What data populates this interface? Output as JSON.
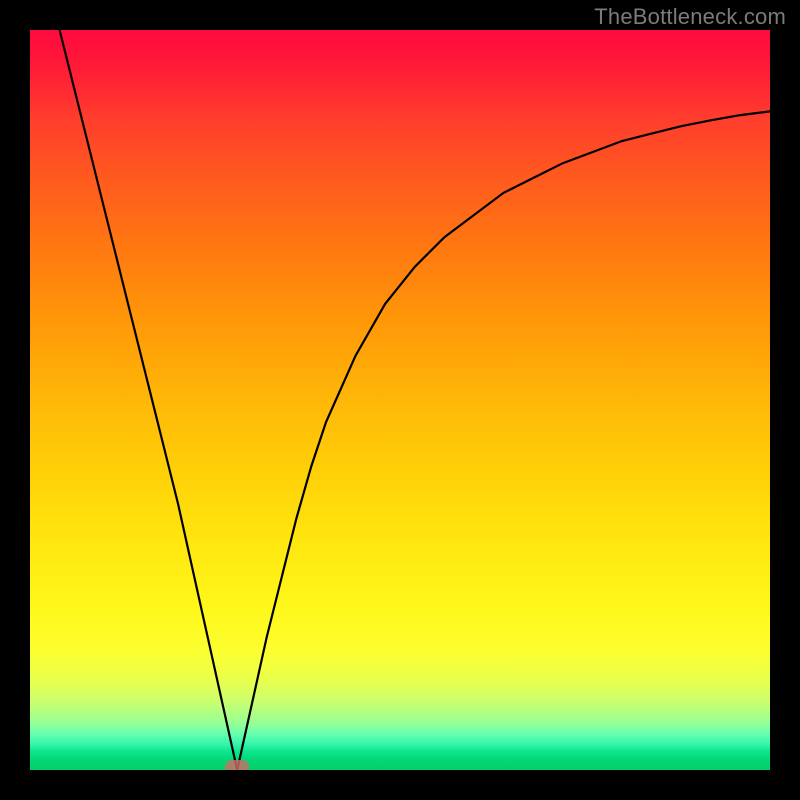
{
  "watermark": "TheBottleneck.com",
  "chart_data": {
    "type": "line",
    "title": "",
    "xlabel": "",
    "ylabel": "",
    "xlim": [
      0,
      100
    ],
    "ylim": [
      0,
      100
    ],
    "grid": false,
    "legend": false,
    "min_point": {
      "x": 28,
      "y": 0
    },
    "series": [
      {
        "name": "curve",
        "points": [
          {
            "x": 4,
            "y": 100
          },
          {
            "x": 6,
            "y": 92
          },
          {
            "x": 8,
            "y": 84
          },
          {
            "x": 10,
            "y": 76
          },
          {
            "x": 12,
            "y": 68
          },
          {
            "x": 14,
            "y": 60
          },
          {
            "x": 16,
            "y": 52
          },
          {
            "x": 18,
            "y": 44
          },
          {
            "x": 20,
            "y": 36
          },
          {
            "x": 22,
            "y": 27
          },
          {
            "x": 24,
            "y": 18
          },
          {
            "x": 26,
            "y": 9
          },
          {
            "x": 28,
            "y": 0
          },
          {
            "x": 30,
            "y": 9
          },
          {
            "x": 32,
            "y": 18
          },
          {
            "x": 34,
            "y": 26
          },
          {
            "x": 36,
            "y": 34
          },
          {
            "x": 38,
            "y": 41
          },
          {
            "x": 40,
            "y": 47
          },
          {
            "x": 44,
            "y": 56
          },
          {
            "x": 48,
            "y": 63
          },
          {
            "x": 52,
            "y": 68
          },
          {
            "x": 56,
            "y": 72
          },
          {
            "x": 60,
            "y": 75
          },
          {
            "x": 64,
            "y": 78
          },
          {
            "x": 68,
            "y": 80
          },
          {
            "x": 72,
            "y": 82
          },
          {
            "x": 76,
            "y": 83.5
          },
          {
            "x": 80,
            "y": 85
          },
          {
            "x": 84,
            "y": 86
          },
          {
            "x": 88,
            "y": 87
          },
          {
            "x": 92,
            "y": 87.8
          },
          {
            "x": 96,
            "y": 88.5
          },
          {
            "x": 100,
            "y": 89
          }
        ]
      }
    ],
    "gradient_stops": [
      {
        "pos": 0,
        "color": "#ff0b3f"
      },
      {
        "pos": 50,
        "color": "#ffb708"
      },
      {
        "pos": 80,
        "color": "#fcff30"
      },
      {
        "pos": 100,
        "color": "#05cf6a"
      }
    ]
  }
}
